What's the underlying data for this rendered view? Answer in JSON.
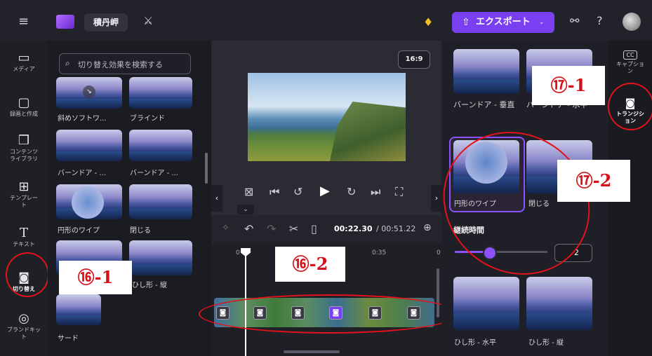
{
  "topbar": {
    "project_title": "積丹岬",
    "export_label": "エクスポート",
    "export_icon": "upload-icon",
    "menu_icon": "hamburger-icon",
    "help_label": "?",
    "aspect_ratio": "16:9"
  },
  "rail": {
    "items": [
      {
        "label": "メディア",
        "icon": "folder-icon"
      },
      {
        "label": "録画と作成",
        "icon": "camera-icon"
      },
      {
        "label": "コンテンツライブラリ",
        "icon": "library-icon"
      },
      {
        "label": "テンプレート",
        "icon": "template-icon"
      },
      {
        "label": "テキスト",
        "icon": "text-icon"
      },
      {
        "label": "切り替え",
        "icon": "transition-icon"
      },
      {
        "label": "ブランドキット",
        "icon": "brand-icon"
      }
    ]
  },
  "library": {
    "search_placeholder": "切り替え効果を検索する",
    "items": [
      {
        "label": "斜めソフトワ..."
      },
      {
        "label": "ブラインド"
      },
      {
        "label": "バーンドア - ..."
      },
      {
        "label": "バーンドア - ..."
      },
      {
        "label": "円形のワイプ"
      },
      {
        "label": "閉じる"
      },
      {
        "label": "ひし形 - 縦"
      },
      {
        "label": "サード"
      }
    ]
  },
  "player": {
    "current_time": "00:22.30",
    "total_time": "/ 00:51.22",
    "ruler_start": "0",
    "ruler_mid": "0:35",
    "ruler_end": "0"
  },
  "right_panel": {
    "items": [
      {
        "label": "バーンドア - 垂直"
      },
      {
        "label": "バーンドア - 水平"
      },
      {
        "label": "円形のワイプ"
      },
      {
        "label": "閉じる"
      },
      {
        "label": "ひし形 - 水平"
      },
      {
        "label": "ひし形 - 縦"
      }
    ],
    "duration_label": "継続時間",
    "duration_value": "2",
    "duration_level": 0.42
  },
  "right_rail": {
    "captions_label": "キャプション",
    "transitions_label": "トランジション"
  },
  "annotations": {
    "c16_1": "⑯-1",
    "c16_2": "⑯-2",
    "c17_1": "⑰-1",
    "c17_2": "⑰-2"
  },
  "colors": {
    "accent": "#7b3ff2",
    "annotation_red": "#e3121b"
  }
}
